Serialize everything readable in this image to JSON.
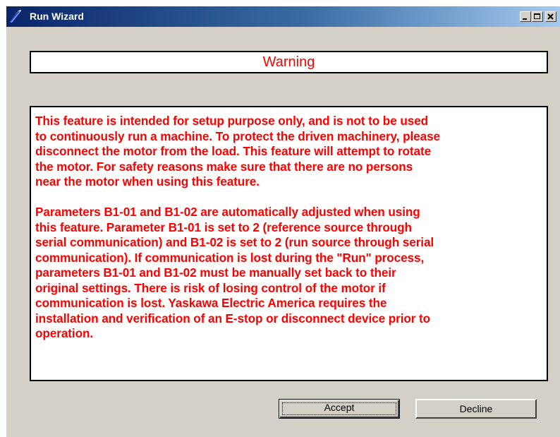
{
  "window": {
    "title": "Run Wizard",
    "icon": "app-wizard-icon",
    "controls": {
      "minimize_icon": "minimize-icon",
      "maximize_icon": "maximize-icon",
      "close_icon": "close-icon"
    }
  },
  "warning": {
    "heading": "Warning",
    "message": "This feature is intended for setup purpose only, and is not to be used\nto continuously run a machine. To protect the driven machinery, please\ndisconnect the motor from the load. This feature will attempt to rotate\nthe motor. For safety reasons make sure that there are no persons\nnear the motor when using this feature.\n\nParameters B1-01 and B1-02 are automatically adjusted when using\nthis feature. Parameter B1-01 is set to 2 (reference source through\nserial communication) and B1-02 is set to 2 (run source through serial\ncommunication). If communication is lost during the \"Run\" process,\nparameters B1-01 and B1-02 must be manually set back to their\noriginal settings. There is risk of losing control of the motor if\ncommunication is lost. Yaskawa Electric America requires the\ninstallation and verification of an E-stop or disconnect device prior to\noperation."
  },
  "buttons": {
    "accept": "Accept",
    "decline": "Decline"
  },
  "colors": {
    "warning_text": "#ff0000",
    "dialog_bg": "#d4d0c8",
    "titlebar_start": "#0a246a",
    "titlebar_end": "#a6caf0"
  }
}
